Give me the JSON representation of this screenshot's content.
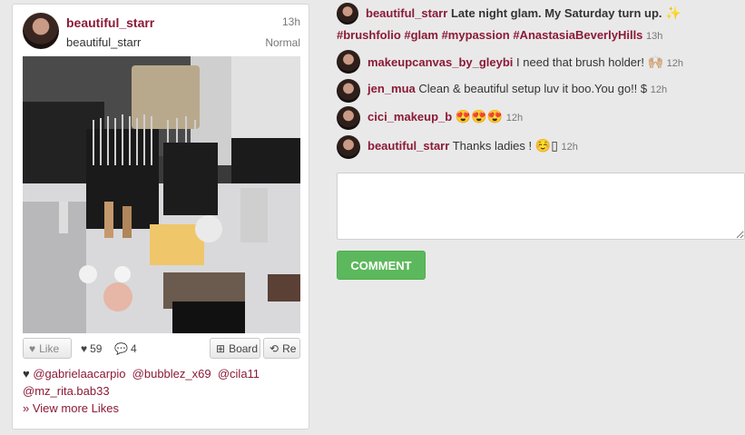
{
  "pin": {
    "username": "beautiful_starr",
    "sub_username": "beautiful_starr",
    "time": "13h",
    "mode": "Normal",
    "photo_alt": "",
    "actions": {
      "like_label": "Like",
      "likes_count": "59",
      "comments_count": "4",
      "board_label": "Board",
      "repin_label": "Re"
    },
    "likers": [
      "@gabrielaacarpio",
      "@bubblez_x69",
      "@cila11",
      "@mz_rita.bab33"
    ],
    "view_more": "» View more Likes"
  },
  "feed": {
    "caption": {
      "user": "beautiful_starr",
      "text": "Late night glam. My Saturday turn up.",
      "emoji": "✨",
      "tags": "#brushfolio #glam #mypassion #AnastasiaBeverlyHills",
      "time": "13h"
    },
    "comments": [
      {
        "user": "makeupcanvas_by_gleybi",
        "text": "I need that brush holder!",
        "emoji": "🙌🏼",
        "time": "12h"
      },
      {
        "user": "jen_mua",
        "text": "Clean & beautiful setup luv it boo.You go!! $",
        "emoji": "",
        "time": "12h"
      },
      {
        "user": "cici_makeup_b",
        "text": "",
        "emoji": "😍😍😍",
        "time": "12h"
      },
      {
        "user": "beautiful_starr",
        "text": "Thanks ladies !",
        "emoji": "☺️▯",
        "time": "12h"
      }
    ]
  },
  "comment_input": {
    "placeholder": ""
  },
  "comment_button": "COMMENT",
  "colors": {
    "accent": "#8b1a37",
    "button_green": "#5cb85c",
    "background": "#e9e9e9"
  }
}
